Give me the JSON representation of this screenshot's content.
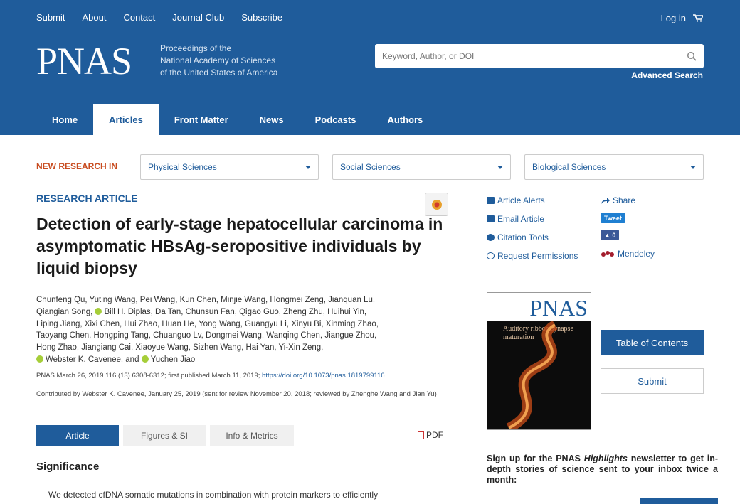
{
  "topnav": {
    "items": [
      "Submit",
      "About",
      "Contact",
      "Journal Club",
      "Subscribe"
    ],
    "login": "Log in"
  },
  "brand": {
    "logo": "PNAS",
    "tagline": [
      "Proceedings of the",
      "National Academy of Sciences",
      "of the United States of America"
    ]
  },
  "search": {
    "placeholder": "Keyword, Author, or DOI",
    "advanced": "Advanced Search"
  },
  "mainnav": {
    "items": [
      "Home",
      "Articles",
      "Front Matter",
      "News",
      "Podcasts",
      "Authors"
    ],
    "active": "Articles"
  },
  "research": {
    "label": "NEW RESEARCH IN",
    "selects": [
      "Physical Sciences",
      "Social Sciences",
      "Biological Sciences"
    ]
  },
  "article": {
    "type": "RESEARCH ARTICLE",
    "title": "Detection of early-stage hepatocellular carcinoma in asymptomatic HBsAg-seropositive individuals by liquid biopsy",
    "authors_lines": [
      "Chunfeng Qu, Yuting Wang, Pei Wang, Kun Chen, Minjie Wang, Hongmei Zeng, Jianquan Lu,",
      "Qiangian Song, ",
      "Bill H. Diplas, Da Tan, Chunsun Fan, Qigao Guo, Zheng Zhu, Huihui Yin,",
      "Liping Jiang, Xixi Chen, Hui Zhao, Huan He, Yong Wang, Guangyu Li, Xinyu Bi, Xinming Zhao,",
      "Taoyang Chen, Hongping Tang, Chuanguo Lv, Dongmei Wang, Wanqing Chen, Jiangue Zhou,",
      "Hong Zhao, Jiangiang Cai, Xiaoyue Wang, Sizhen Wang, Hai Yan, Yi-Xin Zeng,",
      "Webster K. Cavenee, and ",
      "Yuchen Jiao"
    ],
    "citation": "PNAS March 26, 2019 116 (13) 6308-6312; first published March 11, 2019; ",
    "doi": "https://doi.org/10.1073/pnas.1819799116",
    "contributed": "Contributed by Webster K. Cavenee, January 25, 2019 (sent for review November 20, 2018; reviewed by Zhenghe Wang and Jian Yu)"
  },
  "tabs": {
    "items": [
      "Article",
      "Figures & SI",
      "Info & Metrics"
    ],
    "pdf": "PDF"
  },
  "significance": {
    "heading": "Significance",
    "text": "We detected cfDNA somatic mutations in combination with protein markers to efficiently"
  },
  "tools": {
    "left": [
      "Article Alerts",
      "Email Article",
      "Citation Tools",
      "Request Permissions"
    ],
    "share": "Share",
    "tweet": "Tweet",
    "like": "0",
    "mendeley": "Mendeley"
  },
  "cover": {
    "brand": "PNAS",
    "title": "Auditory ribbon synapse maturation"
  },
  "sidebar": {
    "toc": "Table of Contents",
    "submit": "Submit"
  },
  "newsletter": {
    "before": "Sign up for the PNAS ",
    "em": "Highlights",
    "after": " newsletter to get in-depth stories of science sent to your inbox twice a month:"
  },
  "colors": {
    "brand_blue": "#1f5c9b",
    "accent_orange": "#c84b1f",
    "orcid_green": "#a6ce39"
  }
}
